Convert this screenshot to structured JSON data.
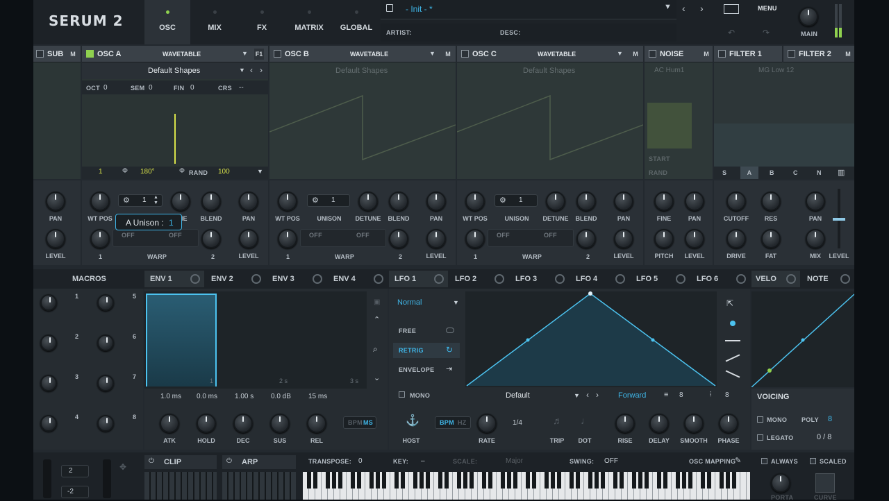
{
  "app": {
    "logo": "SERUM 2"
  },
  "tabs": [
    {
      "label": "OSC",
      "active": true
    },
    {
      "label": "MIX"
    },
    {
      "label": "FX"
    },
    {
      "label": "MATRIX"
    },
    {
      "label": "GLOBAL"
    }
  ],
  "preset": {
    "name": "- Init - *",
    "artist_label": "ARTIST:",
    "desc_label": "DESC:"
  },
  "top_right": {
    "menu": "MENU",
    "main": "MAIN"
  },
  "osc": {
    "sub": "SUB",
    "m": "M",
    "osc_a": "OSC A",
    "osc_b": "OSC B",
    "osc_c": "OSC C",
    "noise": "NOISE",
    "filter1": "FILTER 1",
    "filter2": "FILTER 2",
    "type": "WAVETABLE",
    "f1": "F1",
    "table": "Default Shapes",
    "noise_sample": "AC Hum1",
    "oct": "OCT",
    "oct_val": "0",
    "sem": "SEM",
    "sem_val": "0",
    "fin": "FIN",
    "fin_val": "0",
    "crs": "CRS",
    "crs_val": "--",
    "phase_one": "1",
    "phase": "180°",
    "rand": "RAND",
    "rand_val": "100",
    "start": "START",
    "rand_small": "RAND",
    "unison_val": "1",
    "tooltip": "A Unison :",
    "tooltip_val": "1",
    "filter_modes": [
      "S",
      "A",
      "B",
      "C",
      "N"
    ],
    "filter_type": "MG Low 12",
    "knobs": {
      "pan": "PAN",
      "level": "LEVEL",
      "wt_pos": "WT POS",
      "unison": "UNISON",
      "detune": "DETUNE",
      "blend": "BLEND",
      "warp": "WARP",
      "warp1": "1",
      "warp2": "2",
      "off": "OFF",
      "fine": "FINE",
      "pitch": "PITCH",
      "cutoff": "CUTOFF",
      "res": "RES",
      "drive": "DRIVE",
      "fat": "FAT",
      "mix": "MIX",
      "une": "UNE"
    }
  },
  "mod": {
    "macros": "MACROS",
    "macro_nums": [
      "1",
      "2",
      "3",
      "4",
      "5",
      "6",
      "7",
      "8"
    ],
    "env_tabs": [
      "ENV 1",
      "ENV 2",
      "ENV 3",
      "ENV 4"
    ],
    "lfo_tabs": [
      "LFO 1",
      "LFO 2",
      "LFO 3",
      "LFO 4",
      "LFO 5",
      "LFO 6"
    ],
    "velo": "VELO",
    "note": "NOTE",
    "env_vals": [
      "1.0 ms",
      "0.0 ms",
      "1.00 s",
      "0.0 dB",
      "15 ms"
    ],
    "env_knobs": [
      "ATK",
      "HOLD",
      "DEC",
      "SUS",
      "REL"
    ],
    "env_time": [
      "1",
      "2 s",
      "3 s"
    ],
    "bpm": "BPM",
    "ms": "MS",
    "hz": "HZ",
    "lfo_mode": "Normal",
    "lfo_modes": [
      "FREE",
      "RETRIG",
      "ENVELOPE"
    ],
    "mono": "MONO",
    "lfo_shape": "Default",
    "lfo_dir": "Forward",
    "grid1": "8",
    "grid2": "8",
    "lfo_knobs": [
      "HOST",
      "RATE",
      "TRIP",
      "DOT",
      "RISE",
      "DELAY",
      "SMOOTH",
      "PHASE"
    ],
    "rate_val": "1/4",
    "voicing": "VOICING",
    "v_mono": "MONO",
    "poly": "POLY",
    "poly_val": "8",
    "legato": "LEGATO",
    "voices": "0 / 8"
  },
  "bottom": {
    "clip": "CLIP",
    "arp": "ARP",
    "transpose": "TRANSPOSE:",
    "transpose_val": "0",
    "key": "KEY:",
    "key_val": "–",
    "scale": "SCALE:",
    "scale_val": "Major",
    "swing": "SWING:",
    "swing_val": "OFF",
    "osc_mapping": "OSC MAPPING",
    "always": "ALWAYS",
    "scaled": "SCALED",
    "pitch_up": "2",
    "pitch_down": "-2",
    "porta": "PORTA",
    "curve": "CURVE"
  }
}
